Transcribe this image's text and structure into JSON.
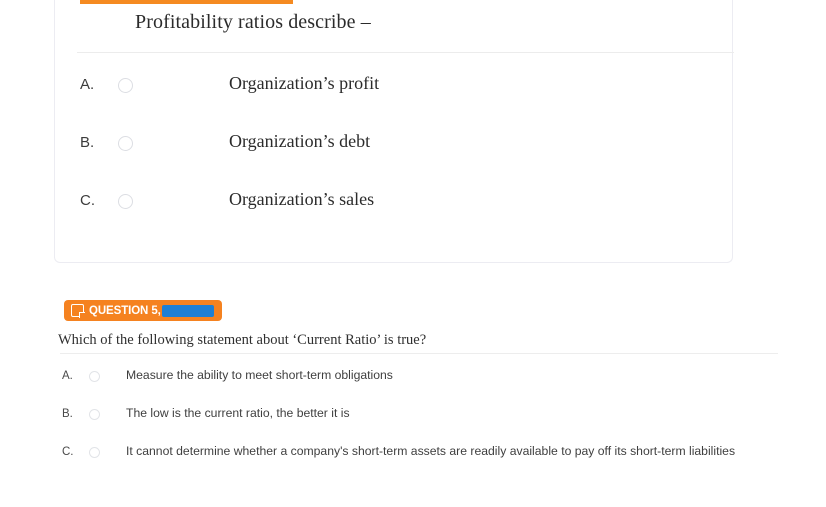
{
  "colors": {
    "accent_orange": "#f58a21",
    "badge_orange": "#f58220",
    "redaction_blue": "#1e7fd4",
    "card_border": "#ececf2",
    "divider": "#ededed",
    "text_primary": "#2b2b2b"
  },
  "question_card": {
    "title": "Profitability ratios describe –",
    "options": [
      {
        "letter": "A.",
        "text": "Organization’s profit",
        "selected": false
      },
      {
        "letter": "B.",
        "text": "Organization’s debt",
        "selected": false
      },
      {
        "letter": "C.",
        "text": "Organization’s sales",
        "selected": false
      }
    ]
  },
  "question5": {
    "badge": {
      "icon": "note-icon",
      "label": "QUESTION 5,",
      "redacted": true
    },
    "prompt": "Which of the following statement about ‘Current Ratio’ is true?",
    "options": [
      {
        "letter": "A.",
        "text": "Measure the ability to meet short-term obligations",
        "selected": false
      },
      {
        "letter": "B.",
        "text": "The low is the current ratio, the better it is",
        "selected": false
      },
      {
        "letter": "C.",
        "text": "It cannot determine whether a company's short-term assets are readily available to pay off its short-term liabilities",
        "selected": false
      }
    ]
  }
}
